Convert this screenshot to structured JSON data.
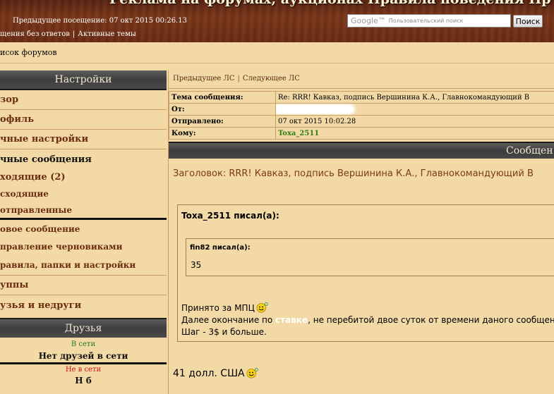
{
  "header": {
    "title": "Реклама на форумах, аукционах   Правила поведения   Пр",
    "prev_visit": "Предыдущее посещение: 07 окт 2015 00:26.13",
    "link_unanswered": "щения без ответов",
    "link_active": "Активные темы",
    "search": {
      "logo": "Google™",
      "placeholder": "Пользовательский поиск",
      "button": "Поиск"
    }
  },
  "breadcrumb": "исок форумов",
  "sidebar": {
    "settings_title": "Настройки",
    "items": {
      "overview": "зор",
      "profile": "офиль",
      "personal_settings": "чные настройки",
      "private_messages": "чные сообщения",
      "inbox": "ходящие (2)",
      "outbox": "сходящие",
      "sent": "отправленные",
      "new_message": "овое сообщение",
      "drafts": "правление черновиками",
      "rules": "равила, папки и настройки",
      "groups": "уппы",
      "friends_foes": "узья и недруги"
    },
    "friends_title": "Друзья",
    "online_label": "В сети",
    "no_friends_online": "Нет друзей в сети",
    "offline_label": "Не в сети",
    "offline_partial": "Н        б"
  },
  "pm": {
    "nav_prev": "Предыдущее ЛС",
    "nav_next": "Следующее ЛС",
    "labels": {
      "subject": "Тема сообщения:",
      "from": "От:",
      "sent": "Отправлено:",
      "to": "Кому:"
    },
    "values": {
      "subject": "Re: RRR! Кавказ, подпись Вершинина К.А., Главнокомандующий В",
      "sent": "07 окт 2015 10:02.28",
      "to": "Toxa_2511"
    },
    "message_bar": "Сообщен",
    "heading": "Заголовок: RRR! Кавказ, подпись Вершинина К.А., Главнокомандующий В",
    "quote": {
      "author": "Toxa_2511 писал(а):",
      "inner_author": "fin82 писал(а):",
      "inner_text": "35",
      "line1": "Принято за МПЦ",
      "line2_before": "Далее окончание по ",
      "line2_highlight": "ставке",
      "line2_after": ", не перебитой двое суток от времени даного сообщения.",
      "line3": "Шаг - 3$ и больше."
    },
    "reply": "41 долл. США"
  },
  "icons": {
    "smiley": "smiley-flower-icon"
  },
  "colors": {
    "page_bg": "#f3d9a6",
    "link_brown": "#6b2d10",
    "online_green": "#1a7d1a",
    "offline_red": "#d01010",
    "dark_bar": "#3e3e3e"
  }
}
